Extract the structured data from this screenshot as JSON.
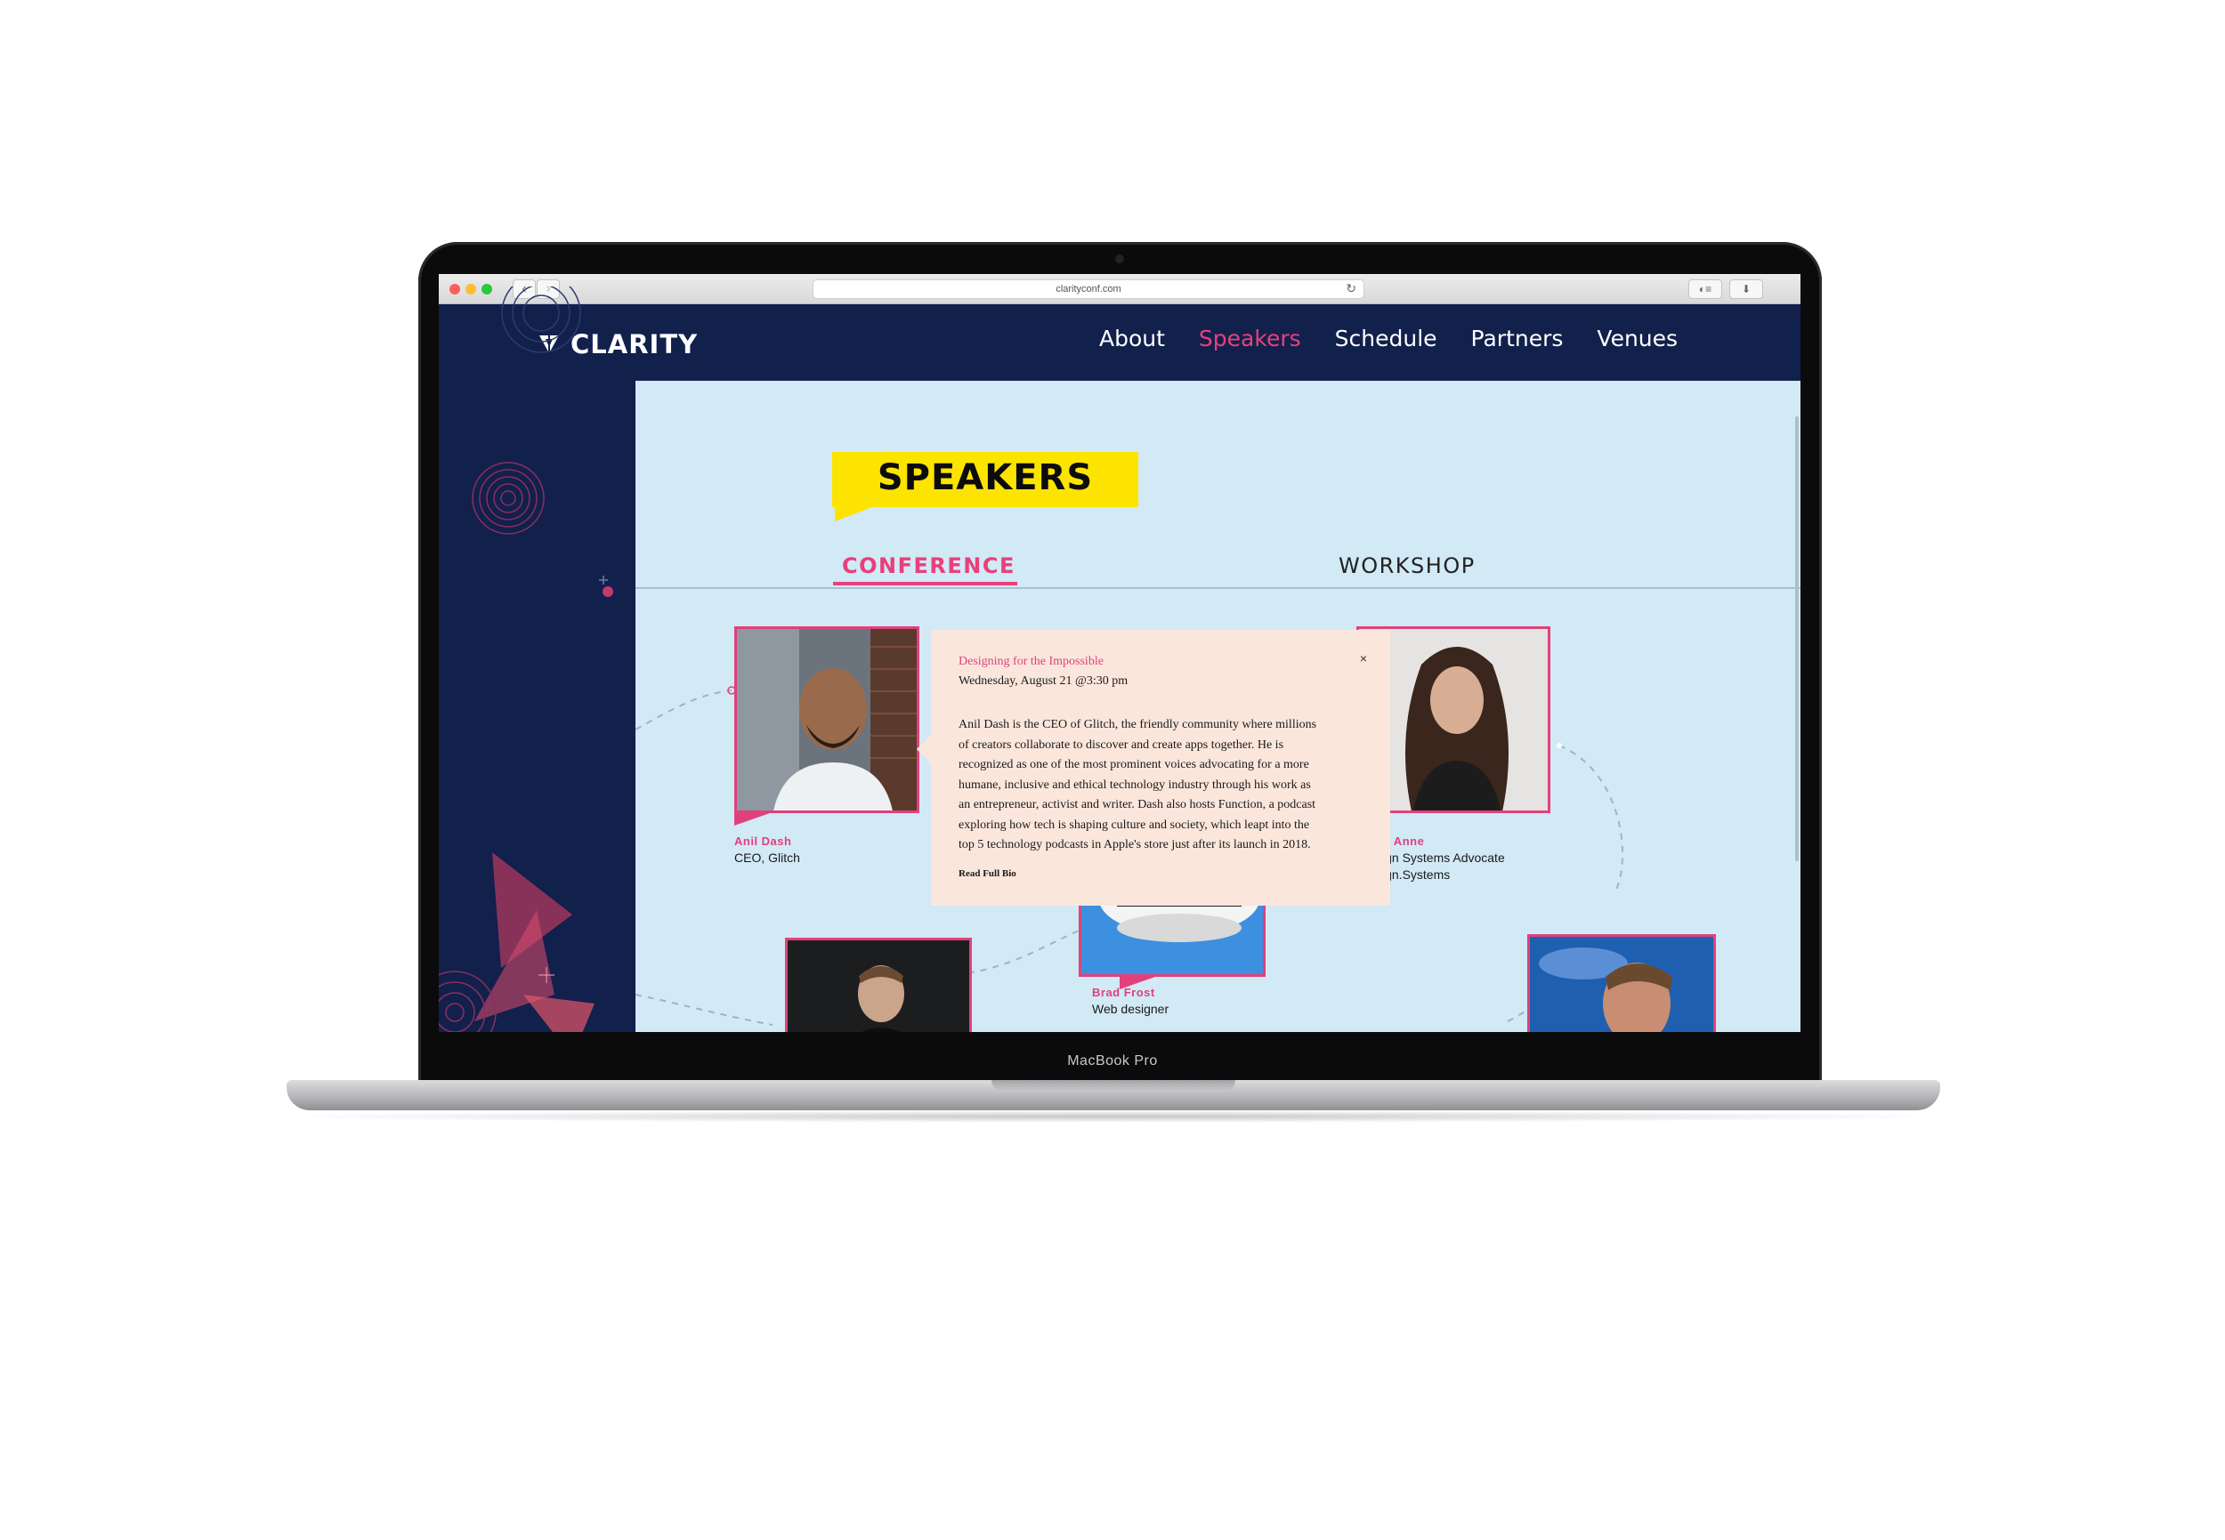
{
  "device": {
    "label": "MacBook Pro"
  },
  "browser": {
    "url": "clarityconf.com"
  },
  "site": {
    "logo_text": "CLARITY",
    "nav": [
      {
        "label": "About",
        "active": false
      },
      {
        "label": "Speakers",
        "active": true
      },
      {
        "label": "Schedule",
        "active": false
      },
      {
        "label": "Partners",
        "active": false
      },
      {
        "label": "Venues",
        "active": false
      }
    ]
  },
  "page": {
    "title": "SPEAKERS",
    "tabs": [
      {
        "label": "CONFERENCE",
        "active": true
      },
      {
        "label": "WORKSHOP",
        "active": false
      }
    ]
  },
  "speakers": [
    {
      "name": "Anil Dash",
      "role": "CEO, Glitch"
    },
    {
      "name": "na Anne",
      "role": "sign Systems Advocate",
      "role2": "sign.Systems"
    },
    {
      "name": "Brad Frost",
      "role": "Web designer"
    }
  ],
  "popup": {
    "talk_title": "Designing for the Impossible",
    "datetime": "Wednesday, August 21 @3:30 pm",
    "close": "×",
    "bio_lines": [
      "Anil Dash is the CEO of Glitch, the friendly community where millions",
      "of creators collaborate to discover and create apps together. He is",
      "recognized as one of the most prominent voices advocating for a more",
      "humane, inclusive and ethical technology industry through his work as",
      "an entrepreneur, activist and writer. Dash also hosts Function, a podcast",
      "exploring how tech is shaping culture and society, which leapt into the",
      "top 5 technology podcasts in Apple's store just after its launch in 2018."
    ],
    "link": "Read Full Bio"
  },
  "colors": {
    "navy": "#12204c",
    "pink": "#e8407a",
    "yellow": "#fce400",
    "light_blue": "#d2e9f6",
    "popup_bg": "#fbe6dc"
  },
  "icons": [
    "back-arrow-icon",
    "forward-arrow-icon",
    "reload-icon",
    "reader-icon",
    "download-icon",
    "clarity-logo-icon",
    "close-icon"
  ]
}
